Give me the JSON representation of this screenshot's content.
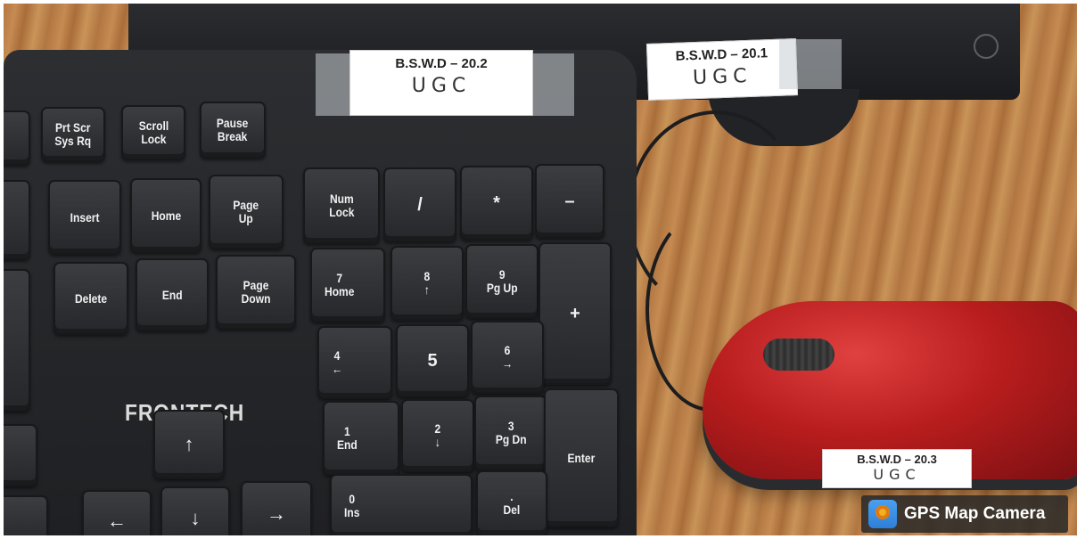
{
  "scene": {
    "description_colors": {
      "desk": "#b8793f",
      "keyboard": "#25272a",
      "mouse": "#b81d1d"
    }
  },
  "labels": {
    "keyboard_tag": {
      "code": "B.S.W.D – 20.2",
      "handwritten": "UGC"
    },
    "monitor_tag": {
      "code": "B.S.W.D – 20.1",
      "handwritten": "UGC"
    },
    "mouse_tag": {
      "code": "B.S.W.D – 20.3",
      "handwritten": "UGC"
    }
  },
  "brand": "FRONTECH",
  "keys": {
    "prtscr": "Prt Scr\nSys Rq",
    "scroll": "Scroll\nLock",
    "pause": "Pause\nBreak",
    "insert": "Insert",
    "home": "Home",
    "pageup": "Page\nUp",
    "delete": "Delete",
    "end": "End",
    "pagedown": "Page\nDown",
    "numlock": "Num\nLock",
    "slash": "/",
    "star": "*",
    "minus": "–",
    "plus": "+",
    "n7": "7\nHome",
    "n8": "8\n↑",
    "n9": "9\nPg Up",
    "n4": "4\n←",
    "n5": "5",
    "n6": "6\n→",
    "n1": "1\nEnd",
    "n2": "2\n↓",
    "n3": "3\nPg Dn",
    "n0": "0\nIns",
    "ndot": ".\nDel",
    "enter": "Enter",
    "up": "↑",
    "down": "↓",
    "left": "←",
    "right": "→"
  },
  "watermark": {
    "text": "GPS Map Camera",
    "icon": "map-pin-icon"
  }
}
